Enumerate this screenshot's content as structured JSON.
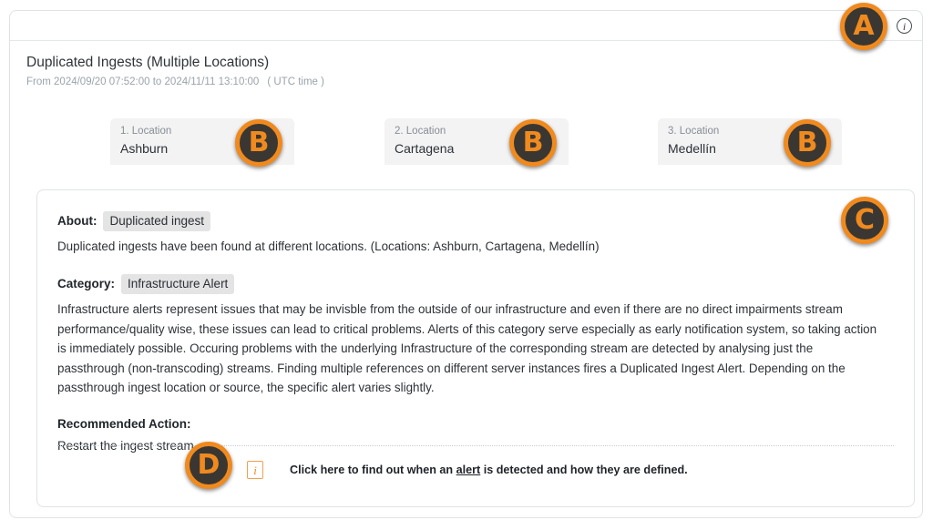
{
  "header": {
    "info_icon": "i"
  },
  "alert": {
    "title": "Duplicated Ingests (Multiple Locations)",
    "range": "From 2024/09/20 07:52:00 to 2024/11/11 13:10:00",
    "timezone": "( UTC time )"
  },
  "locations": [
    {
      "label": "1. Location",
      "value": "Ashburn"
    },
    {
      "label": "2. Location",
      "value": "Cartagena"
    },
    {
      "label": "3. Location",
      "value": "Medellín"
    }
  ],
  "detail": {
    "about_key": "About:",
    "about_pill": "Duplicated ingest",
    "about_text": "Duplicated ingests have been found at different locations. (Locations: Ashburn, Cartagena, Medellín)",
    "category_key": "Category:",
    "category_pill": "Infrastructure Alert",
    "category_text": "Infrastructure alerts represent issues that may be invisble from the outside of our infrastructure and even if there are no direct impairments stream performance/quality wise, these issues can lead to critical problems. Alerts of this category serve especially as early notification system, so taking action is immediately possible. Occuring problems with the underlying Infrastructure of the corresponding stream are detected by analysing just the passthrough (non-transcoding) streams. Finding multiple references on different server instances fires a Duplicated Ingest Alert. Depending on the passthrough ingest location or source, the specific alert varies slightly.",
    "recommended_key": "Recommended Action:",
    "recommended_text": "Restart the ingest stream."
  },
  "footer": {
    "info_icon": "i",
    "text_before": "Click here to find out when an ",
    "text_link": "alert",
    "text_after": " is detected and how they are defined."
  },
  "annotations": {
    "a": "A",
    "b1": "B",
    "b2": "B",
    "b3": "B",
    "c": "C",
    "d": "D"
  },
  "colors": {
    "accent_orange": "#f08a1e",
    "badge_dark": "#3a3733",
    "pill_bg": "#e4e4e5",
    "chip_bg": "#f3f3f4",
    "border": "#dfe3e8"
  }
}
